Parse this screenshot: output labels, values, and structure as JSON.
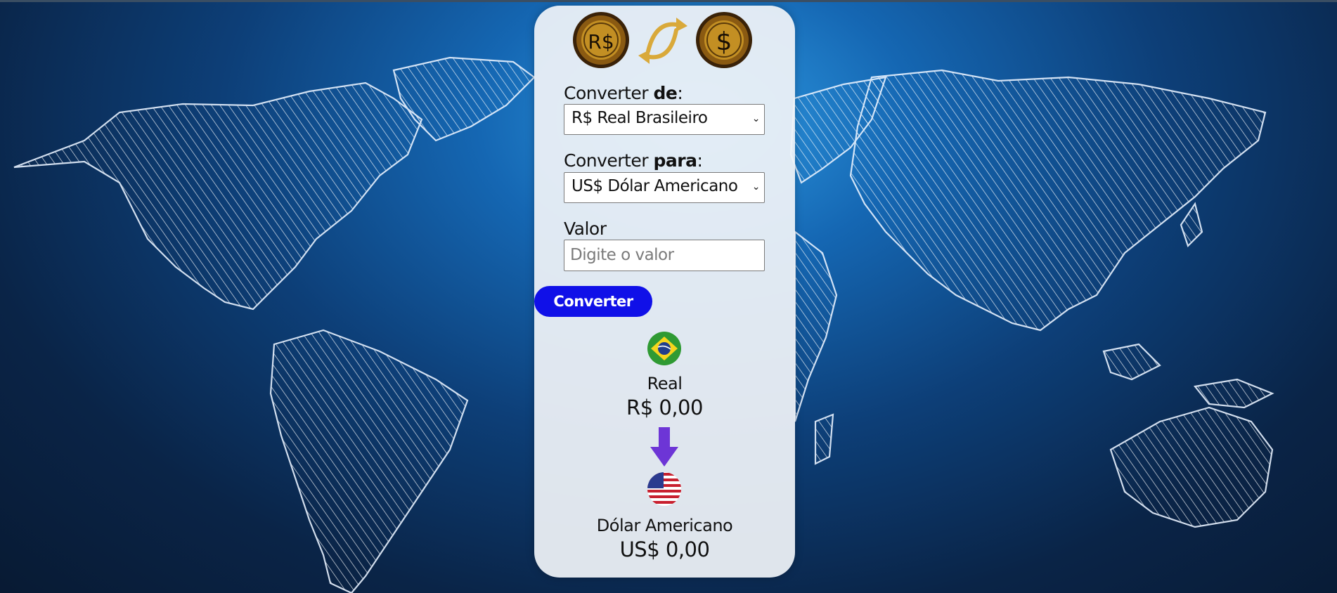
{
  "converter": {
    "from_label": "Converter ",
    "from_label_bold": "de",
    "from_label_suffix": ":",
    "from_value": "R$ Real Brasileiro",
    "to_label": "Converter ",
    "to_label_bold": "para",
    "to_label_suffix": ":",
    "to_value": "US$ Dólar Americano",
    "value_label": "Valor",
    "value_placeholder": "Digite o valor",
    "button_label": "Converter"
  },
  "coins": {
    "left_symbol": "R$",
    "right_symbol": "$"
  },
  "result": {
    "from_name": "Real",
    "from_amount": "R$ 0,00",
    "to_name": "Dólar Americano",
    "to_amount": "US$ 0,00"
  },
  "colors": {
    "button": "#1010e8",
    "arrow": "#6d35d6",
    "coin": "#b8860b"
  }
}
